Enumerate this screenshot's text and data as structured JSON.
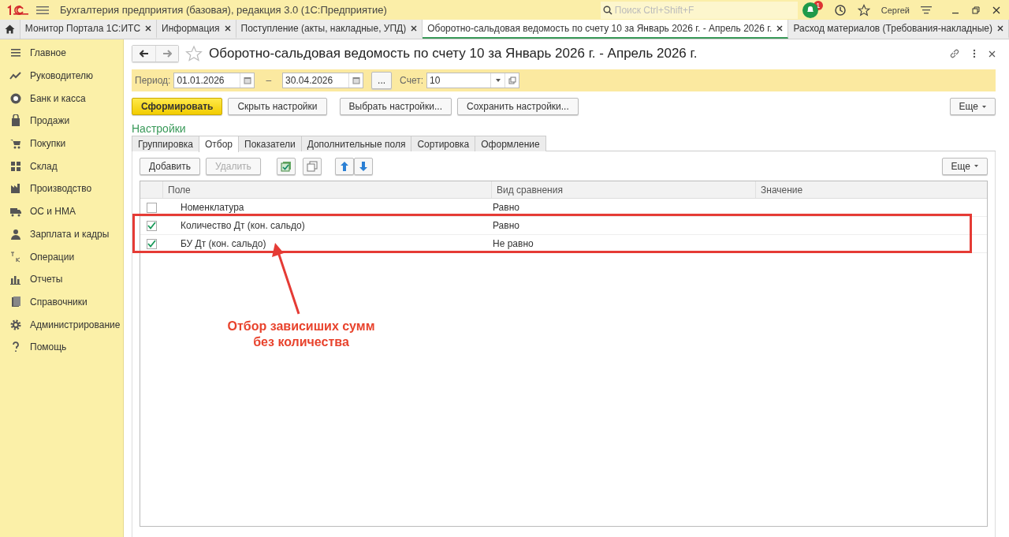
{
  "app": {
    "title": "Бухгалтерия предприятия (базовая), редакция 3.0  (1С:Предприятие)",
    "search_placeholder": "Поиск Ctrl+Shift+F",
    "notifications": "1",
    "user": "Сергей"
  },
  "open_tabs": [
    {
      "label": "Монитор Портала 1С:ИТС",
      "selected": false
    },
    {
      "label": "Информация",
      "selected": false
    },
    {
      "label": "Поступление (акты, накладные, УПД)",
      "selected": false
    },
    {
      "label": "Оборотно-сальдовая ведомость по счету 10 за Январь 2026 г. - Апрель 2026 г.",
      "selected": true
    },
    {
      "label": "Расход материалов (Требования-накладные)",
      "selected": false
    }
  ],
  "sidebar": {
    "items": [
      {
        "label": "Главное"
      },
      {
        "label": "Руководителю"
      },
      {
        "label": "Банк и касса"
      },
      {
        "label": "Продажи"
      },
      {
        "label": "Покупки"
      },
      {
        "label": "Склад"
      },
      {
        "label": "Производство"
      },
      {
        "label": "ОС и НМА"
      },
      {
        "label": "Зарплата и кадры"
      },
      {
        "label": "Операции"
      },
      {
        "label": "Отчеты"
      },
      {
        "label": "Справочники"
      },
      {
        "label": "Администрирование"
      },
      {
        "label": "Помощь"
      }
    ]
  },
  "report": {
    "title": "Оборотно-сальдовая ведомость по счету 10 за Январь 2026 г. - Апрель 2026 г.",
    "period_label": "Период:",
    "date_from": "01.01.2026",
    "dash": "–",
    "date_to": "30.04.2026",
    "period_button": "...",
    "account_label": "Счет:",
    "account": "10",
    "buttons": [
      {
        "label": "Сформировать",
        "kind": "primary"
      },
      {
        "label": "Скрыть настройки",
        "kind": "normal"
      },
      {
        "label": "Выбрать настройки...",
        "kind": "normal"
      },
      {
        "label": "Сохранить настройки...",
        "kind": "normal"
      }
    ],
    "more": "Еще",
    "settings_heading": "Настройки",
    "settings_tabs": [
      {
        "label": "Группировка",
        "selected": false
      },
      {
        "label": "Отбор",
        "selected": true
      },
      {
        "label": "Показатели",
        "selected": false
      },
      {
        "label": "Дополнительные поля",
        "selected": false
      },
      {
        "label": "Сортировка",
        "selected": false
      },
      {
        "label": "Оформление",
        "selected": false
      }
    ],
    "filter_toolbar": {
      "add": {
        "label": "Добавить",
        "disabled": false
      },
      "delete": {
        "label": "Удалить",
        "disabled": true
      },
      "more": "Еще"
    },
    "table": {
      "columns": [
        "Поле",
        "Вид сравнения",
        "Значение"
      ],
      "rows": [
        {
          "checked": false,
          "field": "Номенклатура",
          "comparison": "Равно"
        },
        {
          "checked": true,
          "field": "Количество Дт (кон. сальдо)",
          "comparison": "Равно"
        },
        {
          "checked": true,
          "field": "БУ Дт (кон. сальдо)",
          "comparison": "Не равно"
        }
      ]
    }
  },
  "annotation": {
    "lines": [
      "Отбор зависиших сумм",
      "без количества"
    ]
  }
}
